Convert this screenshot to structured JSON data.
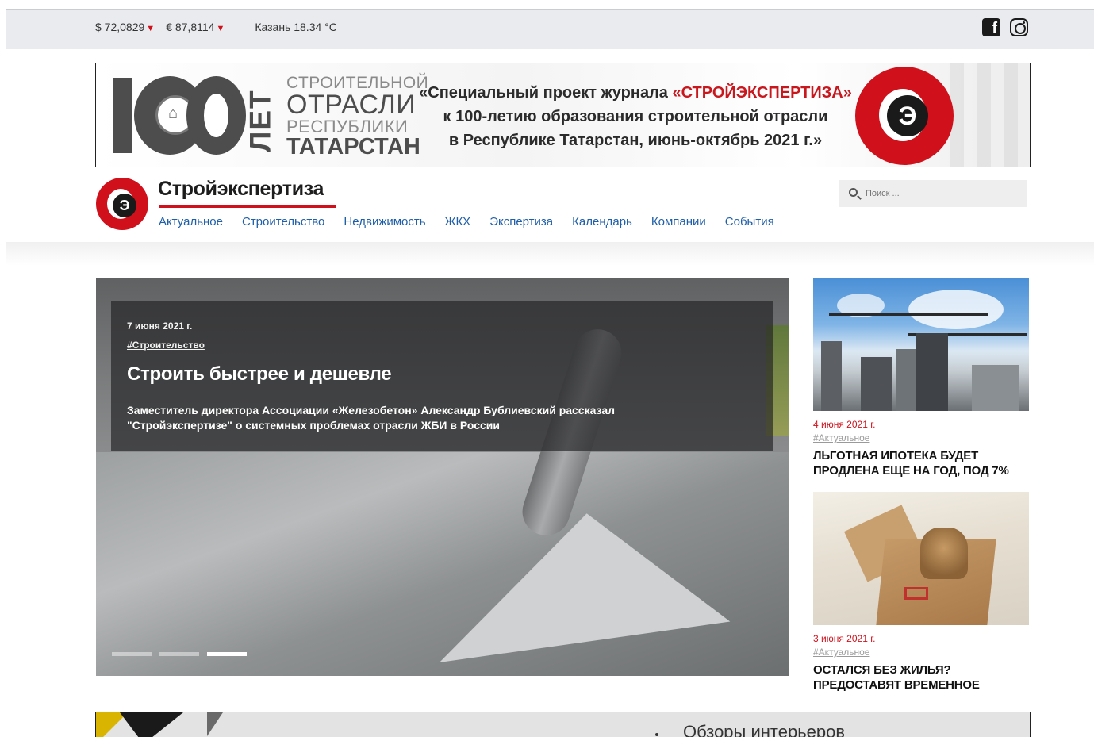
{
  "topbar": {
    "usd": "$ 72,0829",
    "eur": "€ 87,8114",
    "down_arrow": "▼",
    "weather": "Казань 18.34 °C",
    "social": {
      "facebook": "f"
    }
  },
  "banner": {
    "years": "100",
    "years_unit": "ЛЕТ",
    "org_l1": "СТРОИТЕЛЬНОЙ",
    "org_l2": "ОТРАСЛИ",
    "org_l3": "РЕСПУБЛИКИ",
    "org_l4": "ТАТАРСТАН",
    "line1_prefix": "«Специальный проект журнала ",
    "line1_brand": "«СТРОЙЭКСПЕРТИЗА»",
    "line2": "к 100-летию образования строительной отрасли",
    "line3": "в Республике Татарстан, июнь-октябрь 2021 г.»",
    "logo_letter": "Э"
  },
  "header": {
    "site_name": "Стройэкспертиза",
    "logo_letter": "Э",
    "nav": [
      "Актуальное",
      "Строительство",
      "Недвижимость",
      "ЖКХ",
      "Экспертиза",
      "Календарь",
      "Компании",
      "События"
    ],
    "search_placeholder": "Поиск ..."
  },
  "hero": {
    "date": "7 июня 2021 г.",
    "tag": "#Строительство",
    "title": "Строить быстрее и дешевле",
    "lead": "Заместитель директора Ассоциации «Железобетон» Александр Бублиевский рассказал \"Стройэкспертизе\" о системных проблемах отрасли ЖБИ в России",
    "slides_total": 3,
    "active_slide": 3
  },
  "side_cards": [
    {
      "date": "4 июня 2021 г.",
      "tag": "#Актуальное",
      "title": "Льготная ипотека будет продлена еще на год, под 7%"
    },
    {
      "date": "3 июня 2021 г.",
      "tag": "#Актуальное",
      "title": "Остался без жилья? Предоставят временное"
    }
  ],
  "bottom_banner": {
    "text": "Обзоры интерьеров"
  },
  "colors": {
    "accent_red": "#d0101b",
    "nav_blue": "#1f5fa8",
    "topbar_bg": "#e9ebee"
  }
}
